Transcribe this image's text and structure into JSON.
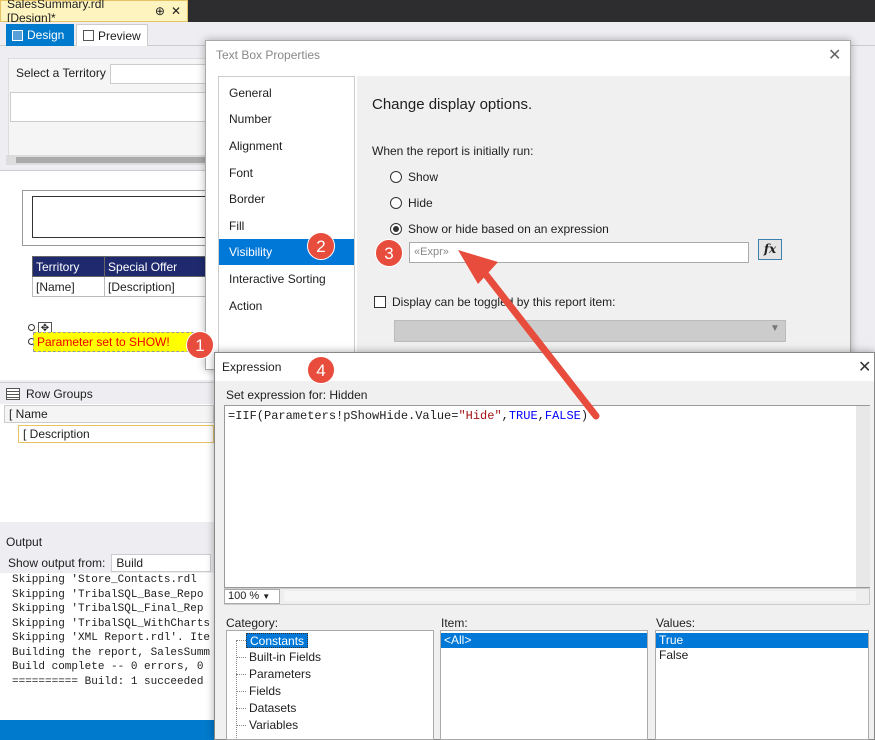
{
  "document_tab": {
    "title": "SalesSummary.rdl [Design]*",
    "pin": "⊕",
    "close": "✕"
  },
  "design_tabs": [
    {
      "label": "Design"
    },
    {
      "label": "Preview"
    }
  ],
  "parameters": {
    "territory_label": "Select a Territory"
  },
  "report_table": {
    "headers": [
      "Territory",
      "Special Offer"
    ],
    "row": [
      "[Name]",
      "[Description]"
    ]
  },
  "param_textbox": "Parameter set to SHOW!",
  "row_groups": {
    "title": "Row Groups",
    "items": [
      "[ Name",
      "[ Description"
    ]
  },
  "output": {
    "title": "Output",
    "show_from_label": "Show output from:",
    "show_from_value": "Build",
    "lines": [
      "Skipping 'Store_Contacts.rdl",
      "Skipping 'TribalSQL_Base_Repo",
      "Skipping 'TribalSQL_Final_Rep",
      "Skipping 'TribalSQL_WithCharts",
      "Skipping 'XML Report.rdl'. Ite",
      "Building the report, SalesSumm",
      "Build complete -- 0 errors, 0",
      "========== Build: 1 succeeded"
    ]
  },
  "text_box_properties": {
    "title": "Text Box Properties",
    "close": "✕",
    "nav": [
      "General",
      "Number",
      "Alignment",
      "Font",
      "Border",
      "Fill",
      "Visibility",
      "Interactive Sorting",
      "Action"
    ],
    "selected_nav": "Visibility",
    "heading": "Change display options.",
    "when_label": "When the report is initially run:",
    "options": [
      "Show",
      "Hide",
      "Show or hide based on an expression"
    ],
    "selected_option": "Show or hide based on an expression",
    "expr_value": "«Expr»",
    "fx_label": "fx",
    "toggle_label": "Display can be toggled by this report item:"
  },
  "expression_dialog": {
    "title": "Expression",
    "close": "✕",
    "set_label": "Set expression for: Hidden",
    "code": {
      "prefix": "=IIF(Parameters!pShowHide.Value=",
      "string": "\"Hide\"",
      "sep1": ",",
      "kw1": "TRUE",
      "sep2": ",",
      "kw2": "FALSE",
      "suffix": ")"
    },
    "zoom": "100 %",
    "category_label": "Category:",
    "item_label": "Item:",
    "values_label": "Values:",
    "categories": [
      "Constants",
      "Built-in Fields",
      "Parameters",
      "Fields",
      "Datasets",
      "Variables"
    ],
    "items": [
      "<All>"
    ],
    "values": [
      "True",
      "False"
    ]
  },
  "callouts": [
    "1",
    "2",
    "3",
    "4"
  ],
  "colors": {
    "accent": "#007acc",
    "callout": "#e74c3c",
    "selection": "#0078d7",
    "highlight": "#ffff00"
  }
}
